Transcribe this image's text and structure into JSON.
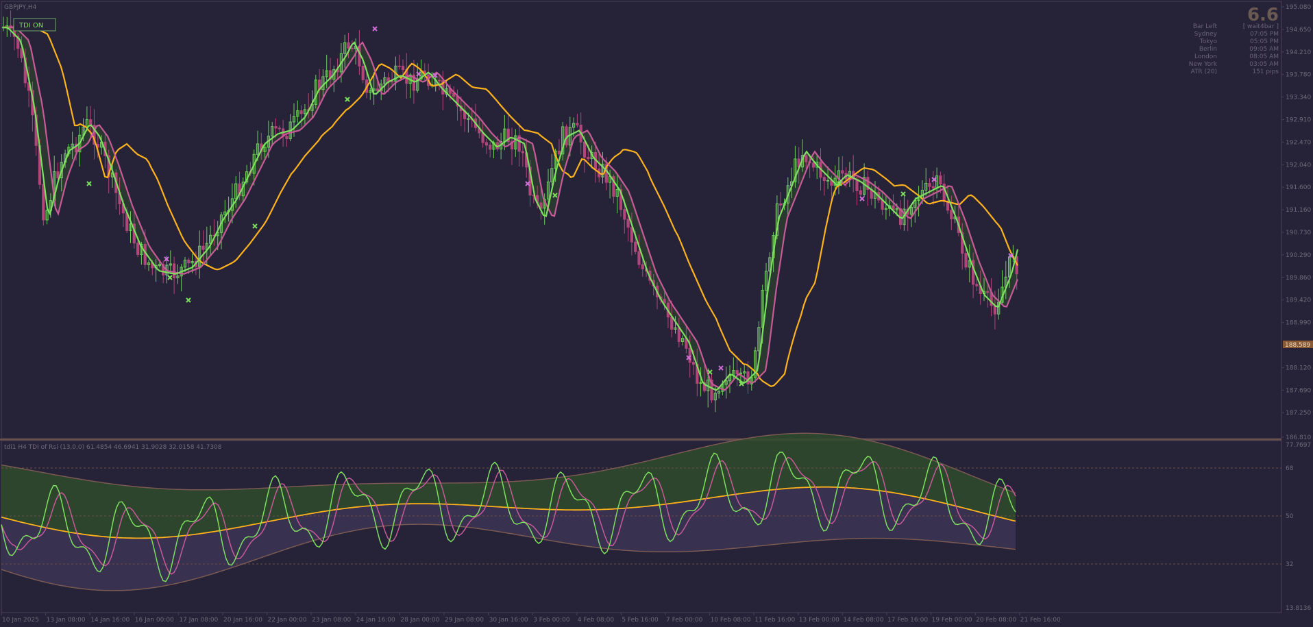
{
  "window": {
    "title": "GBPJPY,H4",
    "tdi_button_label": "TDI ON"
  },
  "info_panel": {
    "big_value": "6.6",
    "rows": [
      {
        "label": "Bar Left",
        "value": "[ wait4bar ]"
      },
      {
        "label": "Sydney",
        "value": "07:05 PM"
      },
      {
        "label": "Tokyo",
        "value": "05:05 PM"
      },
      {
        "label": "Berlin",
        "value": "09:05 AM"
      },
      {
        "label": "London",
        "value": "08:05 AM"
      },
      {
        "label": "New York",
        "value": "03:05 AM"
      },
      {
        "label": "ATR (20)",
        "value": "151 pips"
      }
    ]
  },
  "main_panel": {
    "price_ticks": [
      "195.080",
      "194.650",
      "194.210",
      "193.780",
      "193.340",
      "192.910",
      "192.470",
      "192.040",
      "191.600",
      "191.160",
      "190.730",
      "190.290",
      "189.860",
      "189.420",
      "188.990",
      "188.120",
      "187.690",
      "187.250",
      "186.810"
    ],
    "current_price": "188.589"
  },
  "indicator_panel": {
    "header": "tdi1 H4 TDI of Rsi (13,0,0) 61.4854 46.6941 31.9028 32.0158 41.7308",
    "levels": [
      "77.7697",
      "68",
      "50",
      "32",
      "13.8136"
    ]
  },
  "time_axis": [
    "10 Jan 2025",
    "13 Jan 08:00",
    "14 Jan 16:00",
    "16 Jan 00:00",
    "17 Jan 08:00",
    "20 Jan 16:00",
    "22 Jan 00:00",
    "23 Jan 08:00",
    "24 Jan 16:00",
    "28 Jan 00:00",
    "29 Jan 08:00",
    "30 Jan 16:00",
    "3 Feb 00:00",
    "4 Feb 08:00",
    "5 Feb 16:00",
    "7 Feb 00:00",
    "10 Feb 08:00",
    "11 Feb 16:00",
    "13 Feb 00:00",
    "14 Feb 08:00",
    "17 Feb 16:00",
    "19 Feb 00:00",
    "20 Feb 08:00",
    "21 Feb 16:00"
  ],
  "colors": {
    "background": "#262338",
    "bull_candle": "#6fce5c",
    "bear_candle": "#b2467a",
    "fast_line": "#7ee05f",
    "signal_line": "#c85a9a",
    "slow_line": "#ffb21c",
    "band": "#7a5a52",
    "cloud_green": "#2f4a2c",
    "cloud_purple": "#3b3352",
    "axis_text": "#6e6a78",
    "info_text": "#6a6276",
    "big_value": "#6a5a52"
  },
  "icons": {
    "buy_signal": "green-x-marker",
    "sell_signal": "magenta-x-marker"
  }
}
